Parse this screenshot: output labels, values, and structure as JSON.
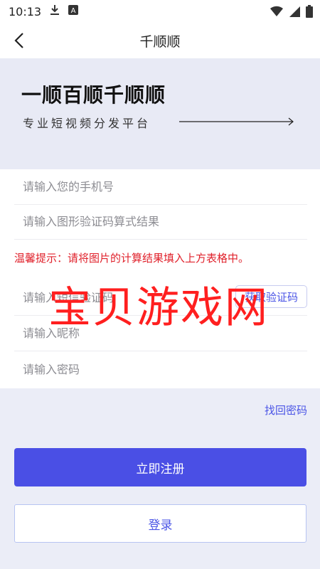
{
  "status_bar": {
    "time": "10:13"
  },
  "nav": {
    "title": "千顺顺"
  },
  "hero": {
    "slogan": "一顺百顺千顺顺",
    "subtitle": "专业短视频分发平台"
  },
  "form": {
    "phone_placeholder": "请输入您的手机号",
    "captcha_placeholder": "请输入图形验证码算式结果",
    "hint": "温馨提示：请将图片的计算结果填入上方表格中。",
    "sms_placeholder": "请输入短信验证码",
    "sms_button": "获取验证码",
    "nickname_placeholder": "请输入昵称",
    "password_placeholder": "请输入密码"
  },
  "forgot_password": "找回密码",
  "register_button": "立即注册",
  "login_button": "登录",
  "watermark": "宝贝游戏网",
  "colors": {
    "accent": "#4a4fe5",
    "hint_red": "#e0212b",
    "background": "#ebedf7"
  },
  "icons": [
    "download-icon",
    "font-a-icon",
    "wifi-icon",
    "signal-icon",
    "battery-icon",
    "back-arrow-icon"
  ]
}
